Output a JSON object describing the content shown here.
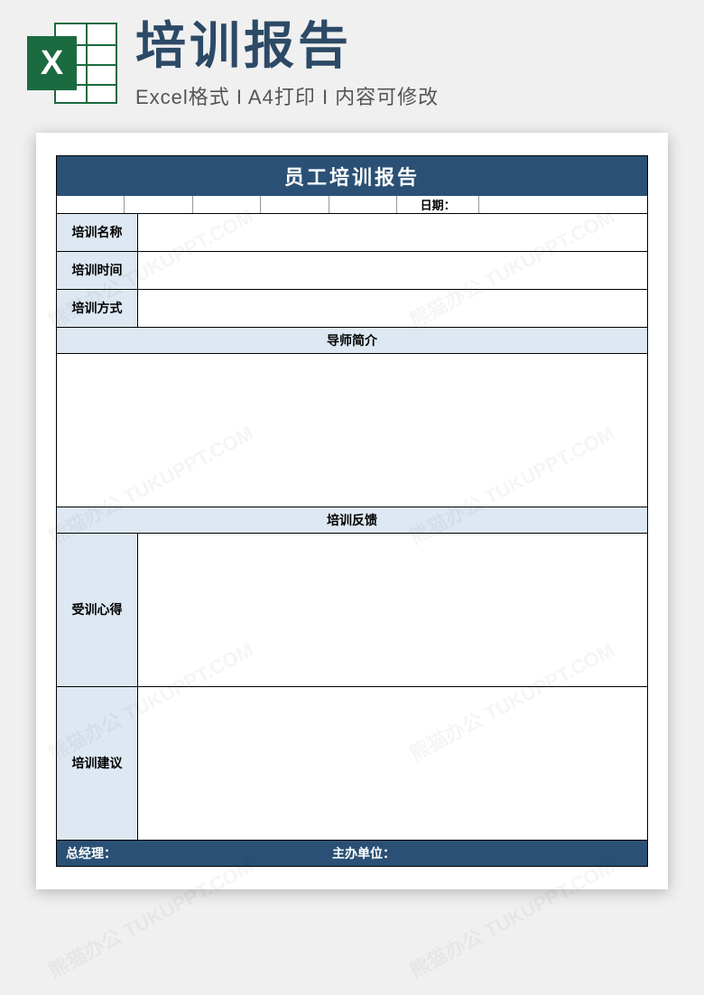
{
  "header": {
    "excel_letter": "X",
    "main_title": "培训报告",
    "subtitle": "Excel格式 I A4打印 I 内容可修改"
  },
  "form": {
    "title": "员工培训报告",
    "date_label": "日期：",
    "rows": {
      "training_name": "培训名称",
      "training_time": "培训时间",
      "training_method": "培训方式"
    },
    "sections": {
      "instructor_intro": "导师简介",
      "training_feedback": "培训反馈",
      "trainee_experience": "受训心得",
      "training_suggestion": "培训建议"
    },
    "footer": {
      "manager": "总经理：",
      "organizer": "主办单位："
    }
  },
  "watermark_text": "熊猫办公 TUKUPPT.COM"
}
